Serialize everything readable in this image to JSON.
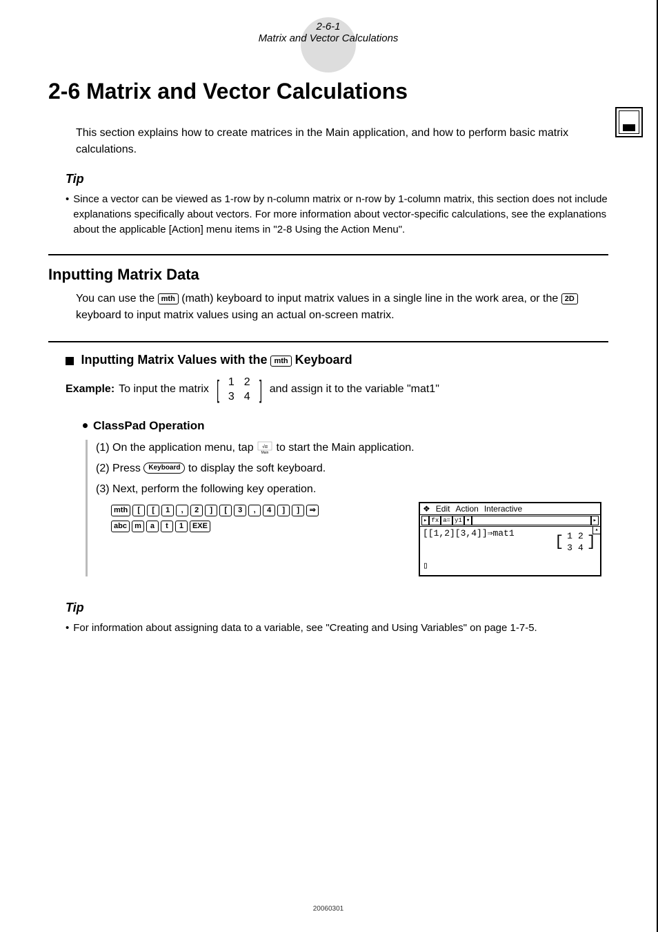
{
  "header": {
    "page_num": "2-6-1",
    "page_title_small": "Matrix and Vector Calculations"
  },
  "h1": "2-6  Matrix and Vector Calculations",
  "intro": "This section explains how to create matrices in the Main application, and how to perform basic matrix calculations.",
  "tip1": {
    "title": "Tip",
    "body": "Since a vector can be viewed as 1-row by n-column matrix or n-row by 1-column matrix, this section does not include explanations specifically about vectors. For more information about vector-specific calculations, see the explanations about the applicable [Action] menu items in \"2-8 Using the Action Menu\"."
  },
  "h2": "Inputting Matrix Data",
  "section_body_pre": "You can use the ",
  "key_mth": "mth",
  "section_body_mid": " (math) keyboard to input matrix values in a single line in the work area, or the ",
  "key_2d": "2D",
  "section_body_post": " keyboard to input matrix values using an actual on-screen matrix.",
  "h3_pre": "Inputting Matrix Values with the ",
  "h3_post": " Keyboard",
  "example": {
    "label": "Example:",
    "pre": "To input the matrix",
    "matrix": [
      [
        "1",
        "2"
      ],
      [
        "3",
        "4"
      ]
    ],
    "post": "and assign it to the variable \"mat1\""
  },
  "op": {
    "title": "ClassPad Operation",
    "steps": [
      {
        "num": "(1)",
        "pre": "On the application menu, tap ",
        "post": " to start the Main application."
      },
      {
        "num": "(2)",
        "pre": "Press ",
        "key": "Keyboard",
        "post": " to display the soft keyboard."
      },
      {
        "num": "(3)",
        "text": "Next, perform the following key operation."
      }
    ],
    "row1": [
      "mth",
      "[",
      "[",
      "1",
      ",",
      "2",
      "]",
      "[",
      "3",
      ",",
      "4",
      "]",
      "]",
      "⇒"
    ],
    "row2": [
      "abc",
      "m",
      "a",
      "t",
      "1",
      "EXE"
    ]
  },
  "calc": {
    "menu": [
      "❖",
      "Edit",
      "Action",
      "Interactive"
    ],
    "toolbar": [
      "▸",
      "fx",
      "a=",
      "y1",
      "▾",
      "",
      "▸"
    ],
    "line": "[[1,2][3,4]]⇒mat1",
    "result": [
      [
        "1",
        "2"
      ],
      [
        "3",
        "4"
      ]
    ],
    "cursor": "▯"
  },
  "tip2": {
    "title": "Tip",
    "body": "For information about assigning data to a variable, see \"Creating and Using Variables\" on page 1-7-5."
  },
  "footer": "20060301"
}
